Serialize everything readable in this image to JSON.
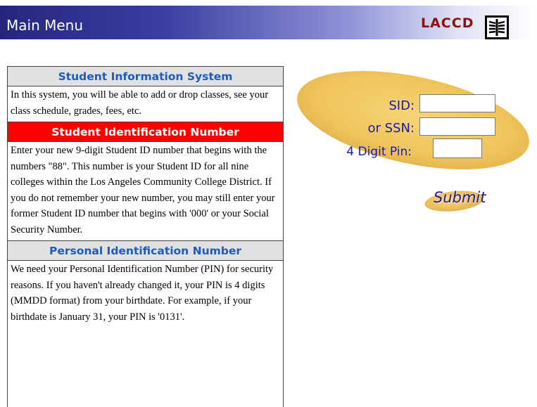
{
  "header": {
    "title": "Main Menu",
    "logo_text": "LACCD"
  },
  "info": {
    "sections": [
      {
        "heading": "Student Information System",
        "body": "In this system, you will be able to add or drop classes, see your class schedule, grades, fees, etc."
      },
      {
        "heading": "Student Identification Number",
        "body": "Enter your new 9-digit Student ID number that begins with the numbers \"88\". This number is your Student ID for all nine colleges within the Los Angeles Community College District. If you do not remember your new number, you may still enter your former Student ID number that begins with '000' or your Social Security Number."
      },
      {
        "heading": "Personal Identification Number",
        "body": "We need your Personal Identification Number (PIN) for security reasons. If you haven't already changed it, your PIN is 4 digits (MMDD format) from your birthdate. For example, if your birthdate is January 31, your PIN is '0131'."
      }
    ]
  },
  "login": {
    "sid_label": "SID:",
    "sid_value": "",
    "ssn_label": "or SSN:",
    "ssn_value": "",
    "pin_label": "4 Digit Pin:",
    "pin_value": "",
    "submit_label": "Submit"
  },
  "colors": {
    "header_dark": "#26267f",
    "logo_red": "#8b1010",
    "section_blue": "#1c5cc0",
    "section_red_bg": "#ff0000",
    "label_blue": "#1a1aa6",
    "ellipse_gold": "#f0c760"
  },
  "icons": {
    "logo_emblem": "laccd-emblem-icon"
  }
}
